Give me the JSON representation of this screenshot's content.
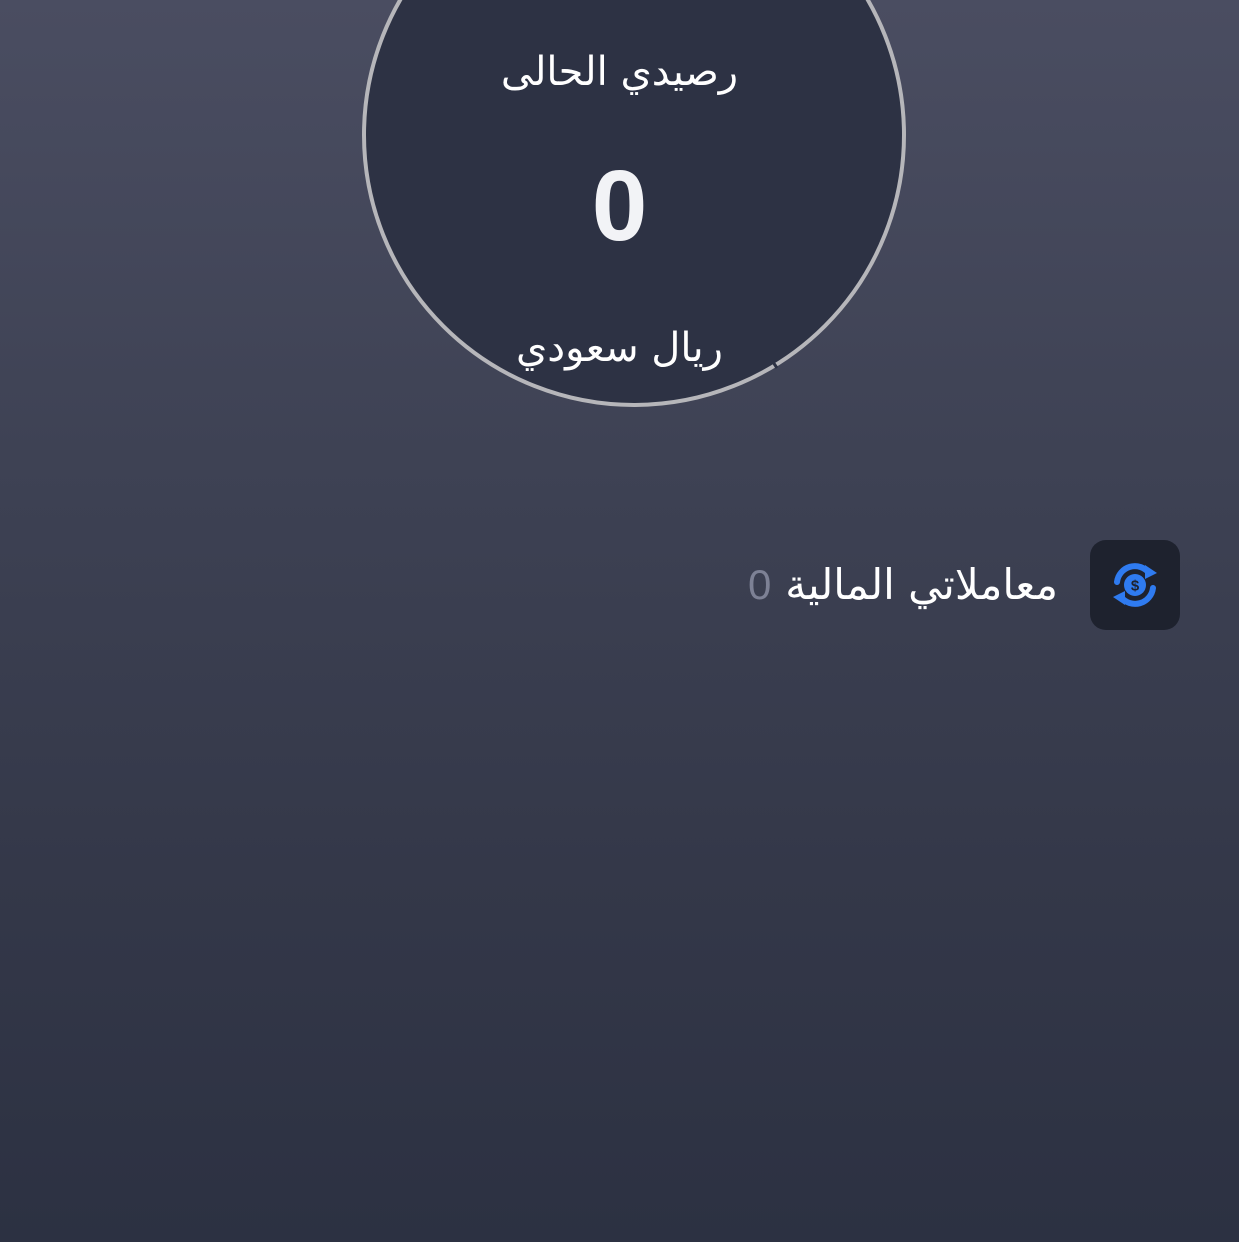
{
  "balance": {
    "title": "رصيدي الحالى",
    "amount": "0",
    "currency": "ريال سعودي"
  },
  "transactions": {
    "label": "معاملاتي المالية",
    "count": "0",
    "icon": "currency-exchange-icon"
  },
  "colors": {
    "accent": "#2f7bf0",
    "circle_bg": "#2d3244",
    "ring": "#b6b6ba",
    "icon_bg": "#1e222e",
    "count_text": "#7d8195"
  }
}
